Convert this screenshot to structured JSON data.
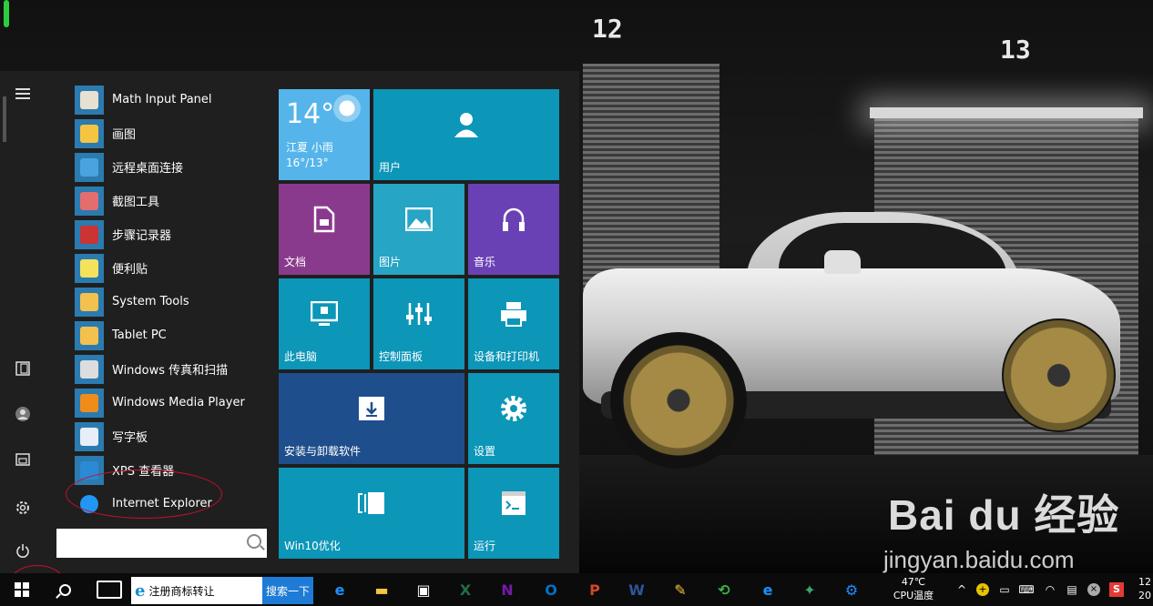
{
  "wallpaper": {
    "garage_numbers": [
      "12",
      "13"
    ],
    "watermark_logo": "Bai du 经验",
    "watermark_site": "jingyan.baidu.com"
  },
  "start_menu": {
    "rail": [
      {
        "name": "expand",
        "icon": "hamburger-icon"
      },
      {
        "name": "tablet-mode",
        "icon": "tablet-icon"
      },
      {
        "name": "user",
        "icon": "user-icon"
      },
      {
        "name": "file-explorer",
        "icon": "folder-icon"
      },
      {
        "name": "settings",
        "icon": "gear-icon"
      },
      {
        "name": "power",
        "icon": "power-icon"
      }
    ],
    "apps": [
      {
        "label": "Math Input Panel",
        "color": "#e8e0d0"
      },
      {
        "label": "画图",
        "color": "#f5c542"
      },
      {
        "label": "远程桌面连接",
        "color": "#4aa3df"
      },
      {
        "label": "截图工具",
        "color": "#e46d6d"
      },
      {
        "label": "步骤记录器",
        "color": "#c33"
      },
      {
        "label": "便利贴",
        "color": "#f4e25c"
      },
      {
        "label": "System Tools",
        "color": "#f2c14e"
      },
      {
        "label": "Tablet PC",
        "color": "#f2c14e"
      },
      {
        "label": "Windows 传真和扫描",
        "color": "#ddd"
      },
      {
        "label": "Windows Media Player",
        "color": "#f08c1a"
      },
      {
        "label": "写字板",
        "color": "#e8eef7"
      },
      {
        "label": "XPS 查看器",
        "color": "#2a8ad6"
      },
      {
        "label": "Internet Explorer",
        "color": "#2196f3"
      }
    ],
    "search": {
      "value": "",
      "placeholder": ""
    },
    "tiles": {
      "weather": {
        "temp": "14°",
        "desc": "江夏 小雨",
        "range": "16°/13°"
      },
      "users": "用户",
      "documents": "文档",
      "pictures": "图片",
      "music": "音乐",
      "this_pc": "此电脑",
      "control_panel": "控制面板",
      "devices_printers": "设备和打印机",
      "install_uninstall": "安装与卸载软件",
      "settings": "设置",
      "win10_optimize": "Win10优化",
      "run": "运行"
    },
    "tile_colors": {
      "weather": "#55b5eb",
      "blue": "#0c96b8",
      "purple": "#8a3a8c",
      "teal": "#26a5c4",
      "violet": "#6a41b5",
      "navy": "#1f4e8c"
    }
  },
  "taskbar": {
    "ie_search_text": "注册商标转让",
    "search_button": "搜索一下",
    "pinned": [
      {
        "name": "edge",
        "glyph": "e",
        "color": "#1e90ff"
      },
      {
        "name": "file-explorer",
        "glyph": "▬",
        "color": "#f4c542"
      },
      {
        "name": "store",
        "glyph": "▣",
        "color": "#ffffff"
      },
      {
        "name": "excel",
        "glyph": "X",
        "color": "#1e7145"
      },
      {
        "name": "onenote",
        "glyph": "N",
        "color": "#7719aa"
      },
      {
        "name": "outlook",
        "glyph": "O",
        "color": "#0072c6"
      },
      {
        "name": "powerpoint",
        "glyph": "P",
        "color": "#d24726"
      },
      {
        "name": "word",
        "glyph": "W",
        "color": "#2b579a"
      },
      {
        "name": "paint",
        "glyph": "✎",
        "color": "#f5c542"
      },
      {
        "name": "green-app",
        "glyph": "⟲",
        "color": "#3cb043"
      },
      {
        "name": "ie",
        "glyph": "e",
        "color": "#1e90ff"
      },
      {
        "name": "sandbox",
        "glyph": "✦",
        "color": "#3aa66b"
      },
      {
        "name": "settings",
        "glyph": "⚙",
        "color": "#1e90ff"
      }
    ],
    "cpu_temp": "47℃",
    "cpu_label": "CPU温度",
    "clock_time": "12",
    "clock_date": "20"
  }
}
